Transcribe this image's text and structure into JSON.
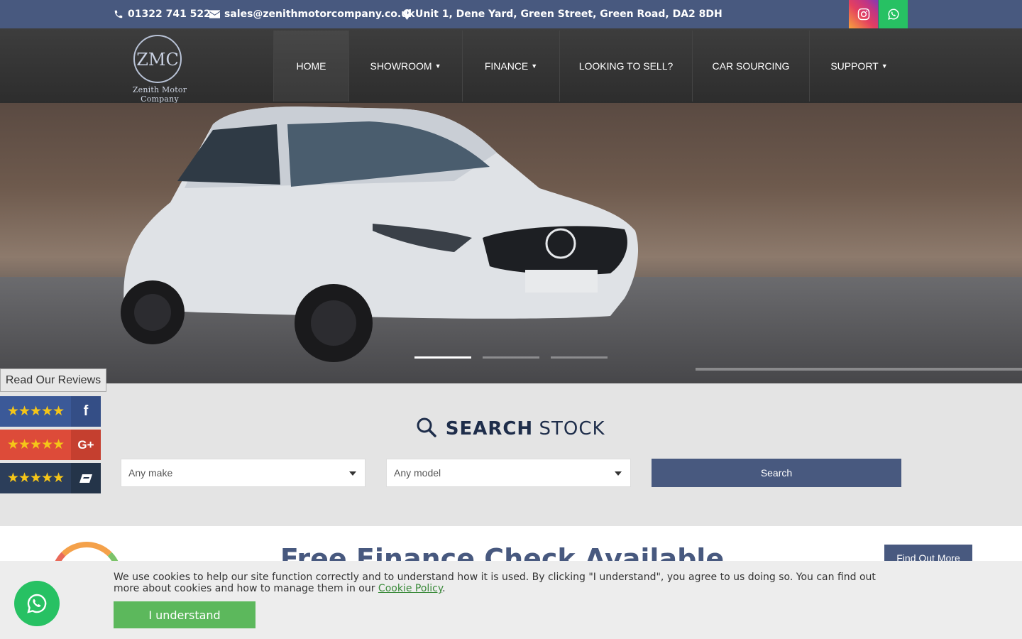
{
  "topbar": {
    "phone": "01322 741 522",
    "email": "sales@zenithmotorcompany.co.uk",
    "address": "Unit 1, Dene Yard, Green Street, Green Road, DA2 8DH"
  },
  "logo": {
    "monogram": "ZMC",
    "name": "Zenith Motor Company"
  },
  "nav": [
    {
      "label": "HOME",
      "has_dropdown": false
    },
    {
      "label": "SHOWROOM",
      "has_dropdown": true
    },
    {
      "label": "FINANCE",
      "has_dropdown": true
    },
    {
      "label": "LOOKING TO SELL?",
      "has_dropdown": false
    },
    {
      "label": "CAR SOURCING",
      "has_dropdown": false
    },
    {
      "label": "SUPPORT",
      "has_dropdown": true
    }
  ],
  "hero": {
    "slides": 3,
    "active_slide": 1
  },
  "reviews": {
    "tab_label": "Read Our Reviews",
    "rows": [
      {
        "stars": "★★★★★",
        "source_icon": "facebook-icon",
        "color": "#3b5998"
      },
      {
        "stars": "★★★★★",
        "source_icon": "google-plus-icon",
        "color": "#dd4b39"
      },
      {
        "stars": "★★★★★",
        "source_icon": "review-site-icon",
        "color": "#2c3e5a"
      }
    ]
  },
  "search": {
    "title_bold": "SEARCH",
    "title_light": "STOCK",
    "make_value": "Any make",
    "model_value": "Any model",
    "button_label": "Search"
  },
  "finance": {
    "heading": "Free Finance Check Available",
    "button_label": "Find Out More"
  },
  "cookie": {
    "message_before": "We use cookies to help our site function correctly and to understand how it is used. By clicking \"I understand\", you agree to us doing so. You can find out more about cookies and how to manage them in our ",
    "link_text": "Cookie Policy",
    "message_after": ".",
    "accept_label": "I understand"
  },
  "colors": {
    "primary": "#48597f",
    "whatsapp": "#27c163",
    "accept": "#5cb85c"
  }
}
